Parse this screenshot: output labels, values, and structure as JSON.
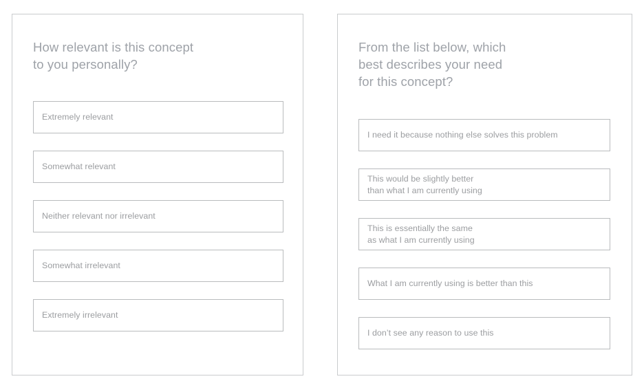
{
  "page": {
    "background_color": "#ffffff",
    "card_border_color": "#c9cbcd",
    "option_border_color": "#b9bbbd",
    "heading_text_color": "#9ea2a8",
    "option_text_color": "#9b9da0"
  },
  "cards": [
    {
      "id": "relevance",
      "heading": "How relevant is this concept\nto you personally?",
      "options": [
        {
          "label": "Extremely relevant"
        },
        {
          "label": "Somewhat relevant"
        },
        {
          "label": "Neither relevant nor irrelevant"
        },
        {
          "label": "Somewhat irrelevant"
        },
        {
          "label": "Extremely irrelevant"
        }
      ]
    },
    {
      "id": "need",
      "heading": "From the list below, which\nbest describes your need\nfor this concept?",
      "options": [
        {
          "label": "I need it because nothing else solves this problem"
        },
        {
          "label": "This would be slightly better\nthan what I am currently using"
        },
        {
          "label": "This is essentially the same\nas what I am currently using"
        },
        {
          "label": "What I am currently using is better than this"
        },
        {
          "label": "I don’t see any reason to use this"
        }
      ]
    }
  ]
}
